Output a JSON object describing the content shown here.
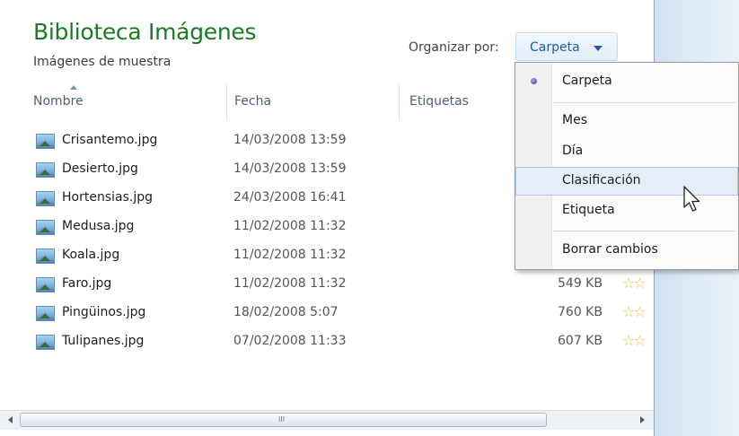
{
  "library": {
    "title": "Biblioteca Imágenes",
    "subtitle": "Imágenes de muestra"
  },
  "organize": {
    "label": "Organizar por:",
    "value": "Carpeta",
    "caret_icon": "chevron-down-icon"
  },
  "columns": {
    "name": "Nombre",
    "date": "Fecha",
    "tags": "Etiquetas"
  },
  "files": [
    {
      "name": "Crisantemo.jpg",
      "date": "14/03/2008 13:59",
      "size": ""
    },
    {
      "name": "Desierto.jpg",
      "date": "14/03/2008 13:59",
      "size": ""
    },
    {
      "name": "Hortensias.jpg",
      "date": "24/03/2008 16:41",
      "size": ""
    },
    {
      "name": "Medusa.jpg",
      "date": "11/02/2008 11:32",
      "size": ""
    },
    {
      "name": "Koala.jpg",
      "date": "11/02/2008 11:32",
      "size": ""
    },
    {
      "name": "Faro.jpg",
      "date": "11/02/2008 11:32",
      "size": "549 KB"
    },
    {
      "name": "Pingüinos.jpg",
      "date": "18/02/2008 5:07",
      "size": "760 KB"
    },
    {
      "name": "Tulipanes.jpg",
      "date": "07/02/2008 11:33",
      "size": "607 KB"
    }
  ],
  "menu": {
    "items": [
      {
        "label": "Carpeta",
        "selected": true
      },
      {
        "label": "Mes"
      },
      {
        "label": "Día"
      },
      {
        "label": "Clasificación",
        "hovered": true
      },
      {
        "label": "Etiqueta"
      },
      {
        "label": "Borrar cambios"
      }
    ]
  },
  "scrollbar": {
    "grip": "III"
  },
  "colors": {
    "title_green": "#1c7a24",
    "link_blue": "#1d5aa6",
    "star_gold": "#e7b53a",
    "menu_hover": "#e6eef9"
  }
}
